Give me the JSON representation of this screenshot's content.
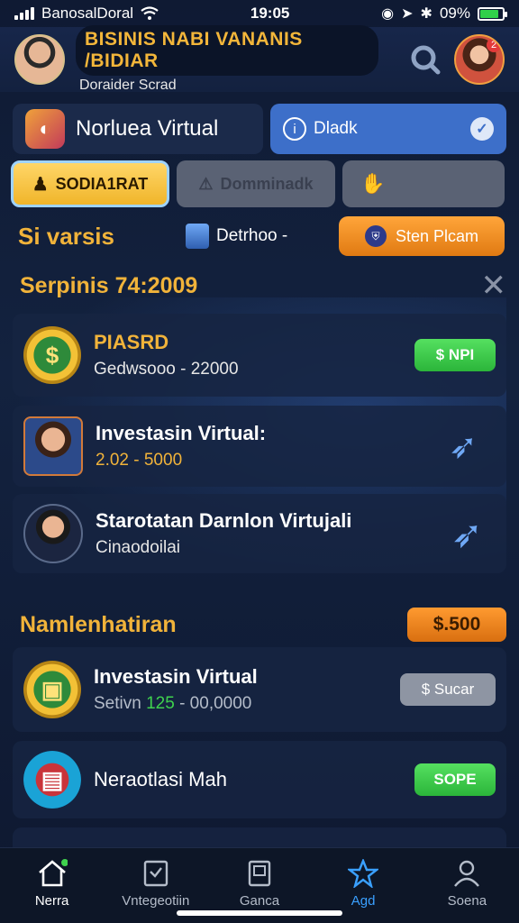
{
  "status": {
    "carrier": "BanosalDoral",
    "time": "19:05",
    "battery": "09%"
  },
  "header": {
    "title": "BISINIS NABI VANANIS /BIDIAR",
    "subtitle": "Doraider Scrad",
    "notif_count": "2"
  },
  "panels": {
    "left_label": "Norluea Virtual",
    "right_label": "Dladk"
  },
  "tabs": [
    {
      "label": "SODIA1RAT"
    },
    {
      "label": "Domminadk"
    },
    {
      "label": ""
    }
  ],
  "filter": {
    "label": "Si varsis",
    "mid_label": "Detrhoo -",
    "button_label": "Sten Plcam"
  },
  "section1": {
    "title": "Serpinis 74:2009"
  },
  "items1": [
    {
      "title": "PIASRD",
      "subtitle": "Gedwsooo - 22000",
      "button": "$ NPI"
    },
    {
      "title": "Investasin Virtual:",
      "subtitle": "2.02 - 5000"
    },
    {
      "title": "Starotatan Darnlon Virtujali",
      "subtitle": "Cinaodoilai"
    }
  ],
  "section2": {
    "title": "Namlenhatiran",
    "price": "$.500"
  },
  "items2": [
    {
      "title": "Investasin Virtual",
      "subtitle_prefix": "Setivn",
      "subtitle_highlight": "125",
      "subtitle_suffix": "- 00,0000",
      "button": "$ Sucar"
    },
    {
      "title": "Neraotlasi Mah",
      "button": "SOPE"
    }
  ],
  "nav": [
    {
      "label": "Nerra",
      "icon": "home-icon"
    },
    {
      "label": "Vntegeotiin",
      "icon": "document-icon"
    },
    {
      "label": "Ganca",
      "icon": "wallet-icon"
    },
    {
      "label": "Agd",
      "icon": "star-icon"
    },
    {
      "label": "Soena",
      "icon": "user-icon"
    }
  ]
}
